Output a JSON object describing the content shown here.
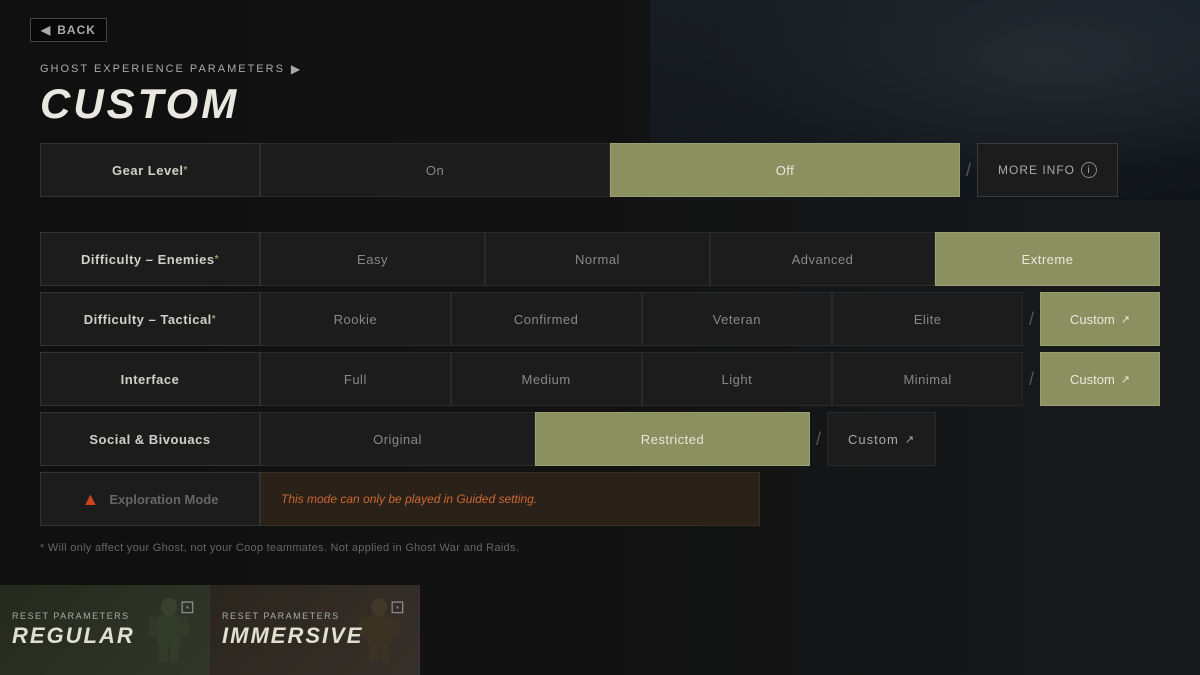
{
  "topBar": {
    "backLabel": "BACK"
  },
  "header": {
    "subTitle": "GHOST EXPERIENCE PARAMETERS",
    "mainTitle": "CUSTOM"
  },
  "rows": {
    "gearLevel": {
      "label": "Gear Level",
      "asterisk": true,
      "options": [
        "On",
        "Off"
      ],
      "selected": "Off",
      "moreInfo": "MORE INFO"
    },
    "difficultyEnemies": {
      "label": "Difficulty – Enemies",
      "asterisk": true,
      "options": [
        "Easy",
        "Normal",
        "Advanced",
        "Extreme"
      ],
      "selected": "Extreme"
    },
    "difficultyTactical": {
      "label": "Difficulty – Tactical",
      "asterisk": true,
      "options": [
        "Rookie",
        "Confirmed",
        "Veteran",
        "Elite"
      ],
      "selected": null,
      "customLabel": "Custom"
    },
    "interface": {
      "label": "Interface",
      "options": [
        "Full",
        "Medium",
        "Light",
        "Minimal"
      ],
      "selected": null,
      "customLabel": "Custom"
    },
    "social": {
      "label": "Social & Bivouacs",
      "options": [
        "Original",
        "Restricted"
      ],
      "selected": "Restricted",
      "customLabel": "Custom"
    },
    "exploration": {
      "label": "Exploration Mode",
      "warningIcon": "▲",
      "message": "This mode can only be played in Guided setting."
    }
  },
  "noteText": "* Will only affect your Ghost, not your Coop teammates. Not applied in Ghost War and Raids.",
  "presets": [
    {
      "sub": "RESET PARAMETERS",
      "name": "REGULAR"
    },
    {
      "sub": "RESET PARAMETERS",
      "name": "IMMERSIVE"
    }
  ]
}
